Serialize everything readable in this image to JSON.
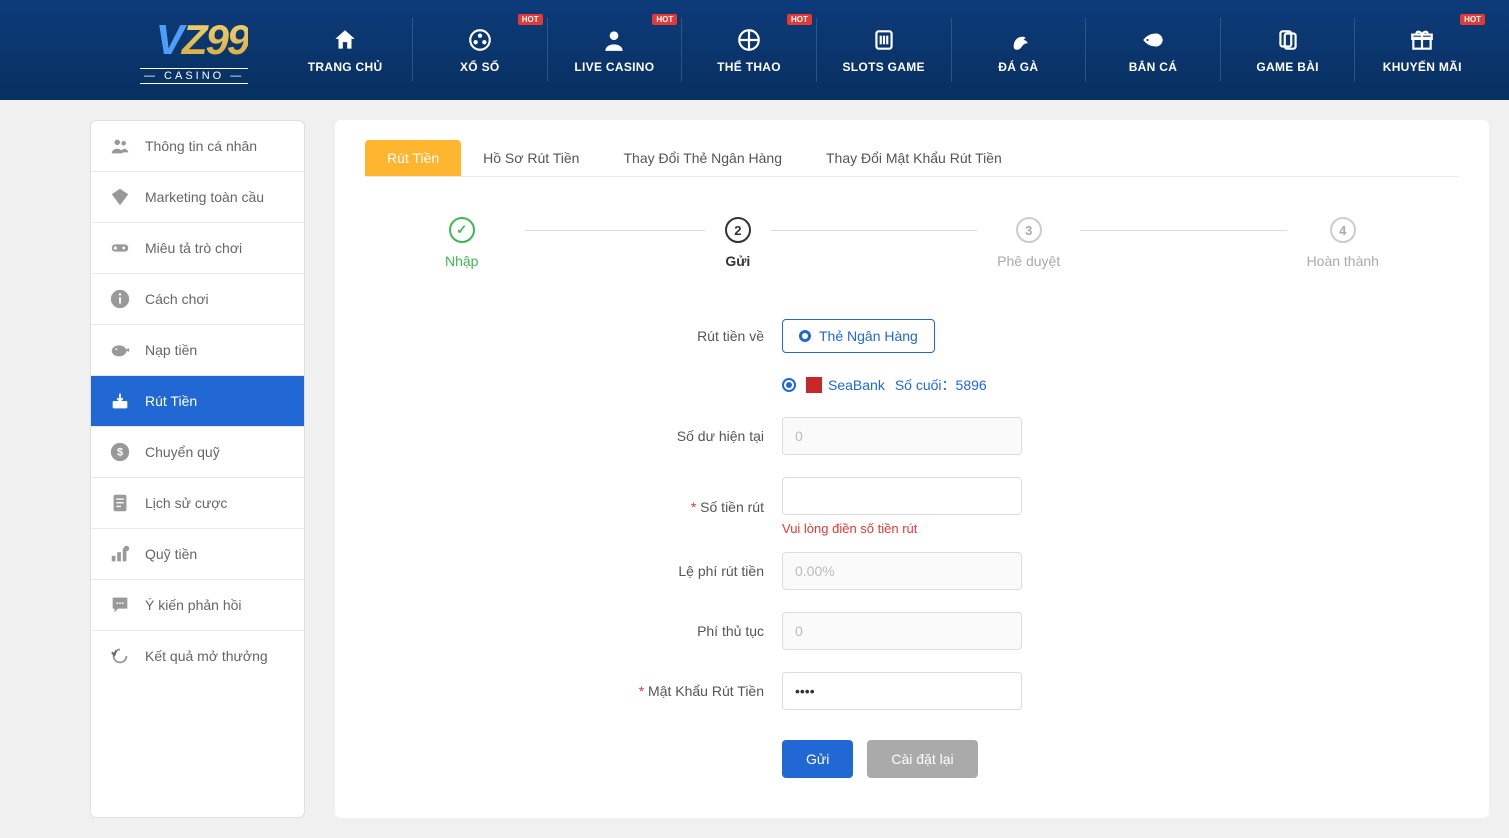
{
  "header": {
    "logo_text": "VZ99",
    "logo_sub": "— CASINO —",
    "hot_label": "HOT",
    "nav": [
      {
        "label": "TRANG CHỦ",
        "icon": "home",
        "hot": false
      },
      {
        "label": "XỔ SỐ",
        "icon": "lottery",
        "hot": true
      },
      {
        "label": "LIVE CASINO",
        "icon": "livecasino",
        "hot": true
      },
      {
        "label": "THỂ THAO",
        "icon": "sports",
        "hot": true
      },
      {
        "label": "SLOTS GAME",
        "icon": "slots",
        "hot": false
      },
      {
        "label": "ĐÁ GÀ",
        "icon": "rooster",
        "hot": false
      },
      {
        "label": "BẮN CÁ",
        "icon": "fish",
        "hot": false
      },
      {
        "label": "GAME BÀI",
        "icon": "cards",
        "hot": false
      },
      {
        "label": "KHUYẾN MÃI",
        "icon": "gift",
        "hot": true
      }
    ]
  },
  "sidebar": {
    "items": [
      {
        "label": "Thông tin cá nhân",
        "icon": "user"
      },
      {
        "label": "Marketing toàn cầu",
        "icon": "diamond"
      },
      {
        "label": "Miêu tả trò chơi",
        "icon": "gamepad"
      },
      {
        "label": "Cách chơi",
        "icon": "info"
      },
      {
        "label": "Nạp tiền",
        "icon": "piggybank"
      },
      {
        "label": "Rút Tiền",
        "icon": "withdraw",
        "active": true
      },
      {
        "label": "Chuyển quỹ",
        "icon": "transfer"
      },
      {
        "label": "Lịch sử cược",
        "icon": "history"
      },
      {
        "label": "Quỹ tiền",
        "icon": "funds"
      },
      {
        "label": "Ý kiến phản hồi",
        "icon": "feedback"
      },
      {
        "label": "Kết quả mở thưởng",
        "icon": "results"
      }
    ]
  },
  "tabs": [
    {
      "label": "Rút Tiền",
      "active": true
    },
    {
      "label": "Hồ Sơ Rút Tiền"
    },
    {
      "label": "Thay Đổi Thẻ Ngân Hàng"
    },
    {
      "label": "Thay Đổi Mật Khẩu Rút Tiền"
    }
  ],
  "steps": [
    {
      "label": "Nhập",
      "state": "done",
      "marker": "✓"
    },
    {
      "label": "Gửi",
      "state": "current",
      "marker": "2"
    },
    {
      "label": "Phê duyệt",
      "state": "pending",
      "marker": "3"
    },
    {
      "label": "Hoàn thành",
      "state": "pending",
      "marker": "4"
    }
  ],
  "form": {
    "withdraw_to_label": "Rút tiền về",
    "bank_card_option": "Thẻ Ngân Hàng",
    "bank_name": "SeaBank",
    "bank_last_label": "Số cuối：",
    "bank_last_value": "5896",
    "balance_label": "Số dư hiện tại",
    "balance_placeholder": "0",
    "amount_label": "Số tiền rút",
    "amount_error": "Vui lòng điền số tiền rút",
    "fee_pct_label": "Lệ phí rút tiền",
    "fee_pct_placeholder": "0.00%",
    "proc_fee_label": "Phí thủ tục",
    "proc_fee_placeholder": "0",
    "password_label": "Mật Khẩu Rút Tiền",
    "password_value": "••••",
    "submit_label": "Gửi",
    "reset_label": "Cài đặt lại"
  }
}
